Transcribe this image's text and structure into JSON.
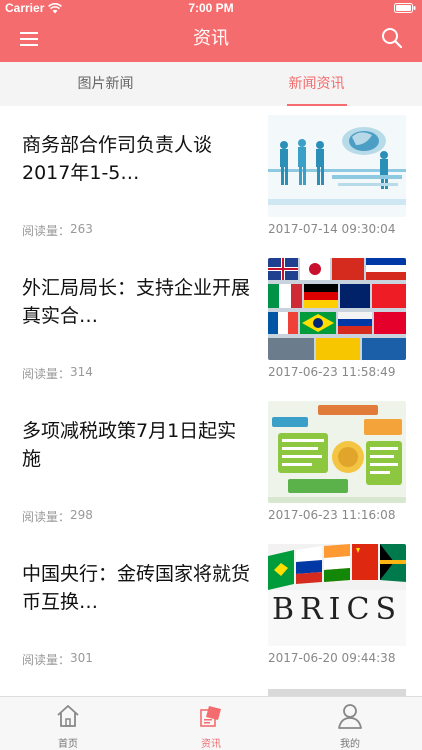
{
  "status": {
    "carrier": "Carrier",
    "time": "7:00 PM"
  },
  "nav": {
    "title": "资讯"
  },
  "tabs": [
    {
      "label": "图片新闻",
      "active": false
    },
    {
      "label": "新闻资讯",
      "active": true
    }
  ],
  "news": [
    {
      "title": "商务部合作司负责人谈2017年1-5…",
      "views_label": "阅读量：",
      "views": "263",
      "date": "2017-07-14 09:30:04",
      "thumb": "business-people-globe-image"
    },
    {
      "title": "外汇局局长：支持企业开展真实合…",
      "views_label": "阅读量：",
      "views": "314",
      "date": "2017-06-23 11:58:49",
      "thumb": "world-flags-image"
    },
    {
      "title": "多项减税政策7月1日起实施",
      "views_label": "阅读量：",
      "views": "298",
      "date": "2017-06-23 11:16:08",
      "thumb": "tax-infographic-image"
    },
    {
      "title": "中国央行：金砖国家将就货币互换…",
      "views_label": "阅读量：",
      "views": "301",
      "date": "2017-06-20 09:44:38",
      "thumb": "brics-flags-image"
    }
  ],
  "tabbar": [
    {
      "label": "首页",
      "icon": "home-icon",
      "active": false
    },
    {
      "label": "资讯",
      "icon": "news-icon",
      "active": true
    },
    {
      "label": "我的",
      "icon": "person-icon",
      "active": false
    }
  ],
  "colors": {
    "accent": "#f46c6e",
    "tab_background": "#f4f4f4",
    "secondary_text": "#999999"
  }
}
